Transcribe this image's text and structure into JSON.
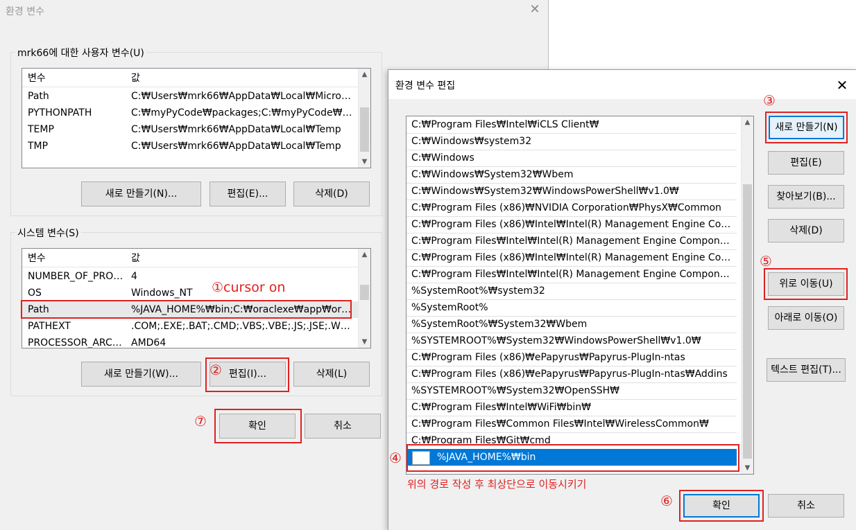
{
  "env_dialog": {
    "title": "환경 변수",
    "close_icon": "close-icon",
    "user_vars": {
      "group_label": "mrk66에 대한 사용자 변수(U)",
      "columns": [
        "변수",
        "값"
      ],
      "rows": [
        {
          "name": "Path",
          "value": "C:₩Users₩mrk66₩AppData₩Local₩Microsoft..."
        },
        {
          "name": "PYTHONPATH",
          "value": "C:₩myPyCode₩packages;C:₩myPyCode₩mo..."
        },
        {
          "name": "TEMP",
          "value": "C:₩Users₩mrk66₩AppData₩Local₩Temp"
        },
        {
          "name": "TMP",
          "value": "C:₩Users₩mrk66₩AppData₩Local₩Temp"
        }
      ],
      "buttons": {
        "new": "새로 만들기(N)...",
        "edit": "편집(E)...",
        "delete": "삭제(D)"
      }
    },
    "system_vars": {
      "group_label": "시스템 변수(S)",
      "columns": [
        "변수",
        "값"
      ],
      "rows": [
        {
          "name": "NUMBER_OF_PROC...",
          "value": "4"
        },
        {
          "name": "OS",
          "value": "Windows_NT"
        },
        {
          "name": "Path",
          "value": "%JAVA_HOME%₩bin;C:₩oraclexe₩app₩orac..."
        },
        {
          "name": "PATHEXT",
          "value": ".COM;.EXE;.BAT;.CMD;.VBS;.VBE;.JS;.JSE;.WSF;..."
        },
        {
          "name": "PROCESSOR_ARCH...",
          "value": "AMD64"
        }
      ],
      "buttons": {
        "new": "새로 만들기(W)...",
        "edit": "편집(I)...",
        "delete": "삭제(L)"
      }
    },
    "ok": "확인",
    "cancel": "취소"
  },
  "edit_dialog": {
    "title": "환경 변수 편집",
    "close_icon": "close-icon",
    "paths": [
      "C:₩Program Files₩Intel₩iCLS Client₩",
      "C:₩Windows₩system32",
      "C:₩Windows",
      "C:₩Windows₩System32₩Wbem",
      "C:₩Windows₩System32₩WindowsPowerShell₩v1.0₩",
      "C:₩Program Files (x86)₩NVIDIA Corporation₩PhysX₩Common",
      "C:₩Program Files (x86)₩Intel₩Intel(R) Management Engine Compo...",
      "C:₩Program Files₩Intel₩Intel(R) Management Engine Components...",
      "C:₩Program Files (x86)₩Intel₩Intel(R) Management Engine Compo...",
      "C:₩Program Files₩Intel₩Intel(R) Management Engine Components...",
      "%SystemRoot%₩system32",
      "%SystemRoot%",
      "%SystemRoot%₩System32₩Wbem",
      "%SYSTEMROOT%₩System32₩WindowsPowerShell₩v1.0₩",
      "C:₩Program Files (x86)₩ePapyrus₩Papyrus-PlugIn-ntas",
      "C:₩Program Files (x86)₩ePapyrus₩Papyrus-PlugIn-ntas₩Addins",
      "%SYSTEMROOT%₩System32₩OpenSSH₩",
      "C:₩Program Files₩Intel₩WiFi₩bin₩",
      "C:₩Program Files₩Common Files₩Intel₩WirelessCommon₩",
      "C:₩Program Files₩Git₩cmd"
    ],
    "selected_path": "%JAVA_HOME%₩bin",
    "buttons": {
      "new": "새로 만들기(N)",
      "edit": "편집(E)",
      "browse": "찾아보기(B)...",
      "delete": "삭제(D)",
      "move_up": "위로 이동(U)",
      "move_down": "아래로 이동(O)",
      "edit_text": "텍스트 편집(T)..."
    },
    "ok": "확인",
    "cancel": "취소"
  },
  "annotations": {
    "step1": "①cursor on",
    "step2": "②",
    "step3": "③",
    "step4": "④",
    "step5": "⑤",
    "step6": "⑥",
    "step7": "⑦",
    "note": "위의 경로 작성 후 최상단으로 이동시키기"
  },
  "colors": {
    "annotation": "#e02020",
    "selection": "#0078d7",
    "dialog_bg": "#f0f0f0"
  }
}
